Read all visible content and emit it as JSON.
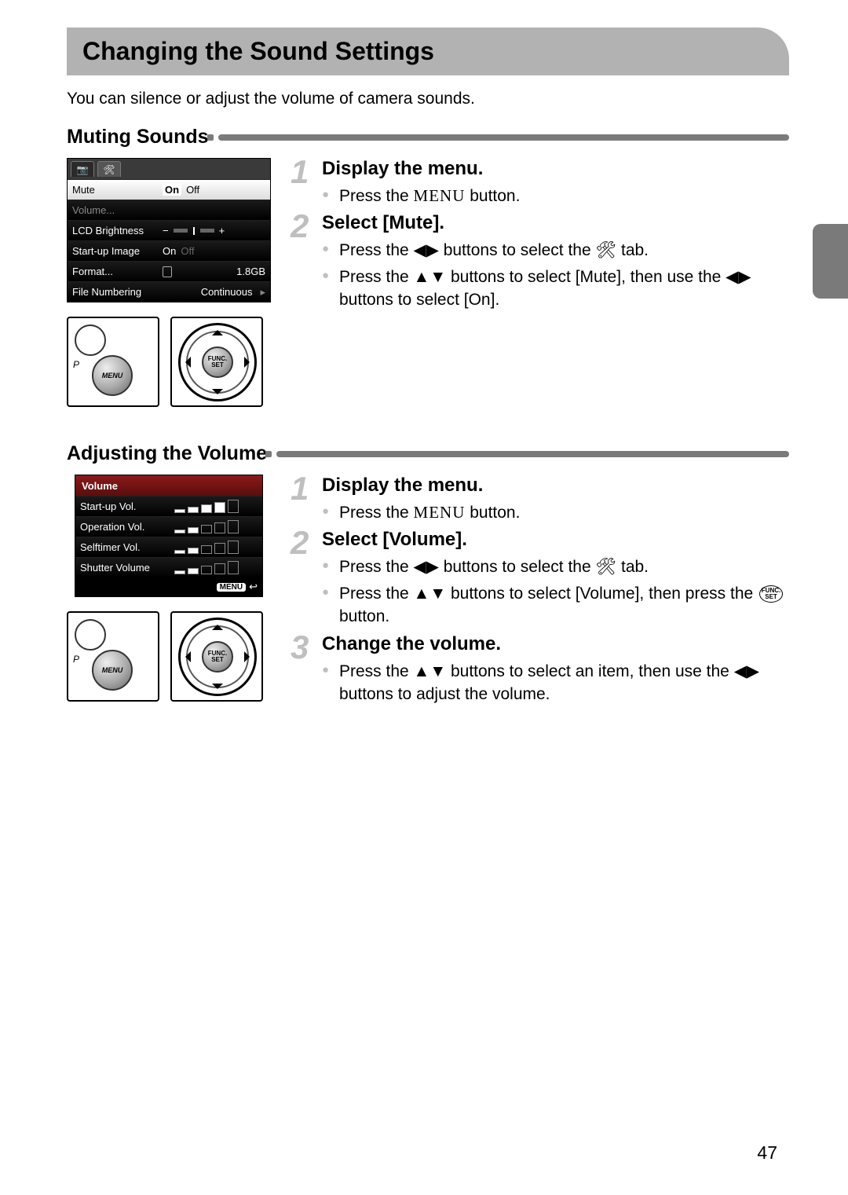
{
  "page_number": "47",
  "title": "Changing the Sound Settings",
  "intro": "You can silence or adjust the volume of camera sounds.",
  "section1": {
    "heading": "Muting Sounds",
    "menu_button_label": "MENU",
    "lcd": {
      "tab_camera": "📷",
      "tab_tools": "🛠",
      "rows": {
        "mute_label": "Mute",
        "mute_on": "On",
        "mute_off": "Off",
        "volume_label": "Volume...",
        "lcd_label": "LCD Brightness",
        "startup_label": "Start-up Image",
        "startup_on": "On",
        "startup_off": "Off",
        "format_label": "Format...",
        "format_val": "1.8GB",
        "filenum_label": "File Numbering",
        "filenum_val": "Continuous"
      }
    },
    "steps": {
      "s1_title": "Display the menu.",
      "s1_b1a": "Press the ",
      "s1_b1b": " button.",
      "s2_title": "Select [Mute].",
      "s2_b1a": "Press the ",
      "s2_b1b": " buttons to select the ",
      "s2_b1c": " tab.",
      "s2_b2a": "Press the ",
      "s2_b2b": " buttons to select [Mute], then use the ",
      "s2_b2c": " buttons to select [On]."
    },
    "glyphs": {
      "menu_text": "MENU",
      "lr": "◀▶",
      "ud": "▲▼",
      "tools": "🛠"
    },
    "ctl": {
      "menu": "MENU",
      "p": "P",
      "func": "FUNC.",
      "set": "SET"
    }
  },
  "section2": {
    "heading": "Adjusting the Volume",
    "lcd": {
      "title": "Volume",
      "rows": {
        "startup": "Start-up Vol.",
        "operation": "Operation Vol.",
        "selftimer": "Selftimer Vol.",
        "shutter": "Shutter Volume"
      },
      "levels": {
        "startup": 4,
        "operation": 2,
        "selftimer": 2,
        "shutter": 2
      },
      "footer_menu": "MENU",
      "footer_back": "↩"
    },
    "steps": {
      "s1_title": "Display the menu.",
      "s1_b1a": "Press the ",
      "s1_b1b": " button.",
      "s2_title": "Select [Volume].",
      "s2_b1a": "Press the ",
      "s2_b1b": " buttons to select the ",
      "s2_b1c": " tab.",
      "s2_b2a": "Press the ",
      "s2_b2b": " buttons to select [Volume], then press the ",
      "s2_b2c": " button.",
      "s3_title": "Change the volume.",
      "s3_b1a": "Press the ",
      "s3_b1b": " buttons to select an item, then use the ",
      "s3_b1c": " buttons to adjust the volume."
    },
    "glyphs": {
      "menu_text": "MENU",
      "lr": "◀▶",
      "ud": "▲▼",
      "tools": "🛠",
      "func": "FUNC.",
      "set": "SET"
    },
    "ctl": {
      "menu": "MENU",
      "p": "P",
      "func": "FUNC.",
      "set": "SET"
    }
  }
}
